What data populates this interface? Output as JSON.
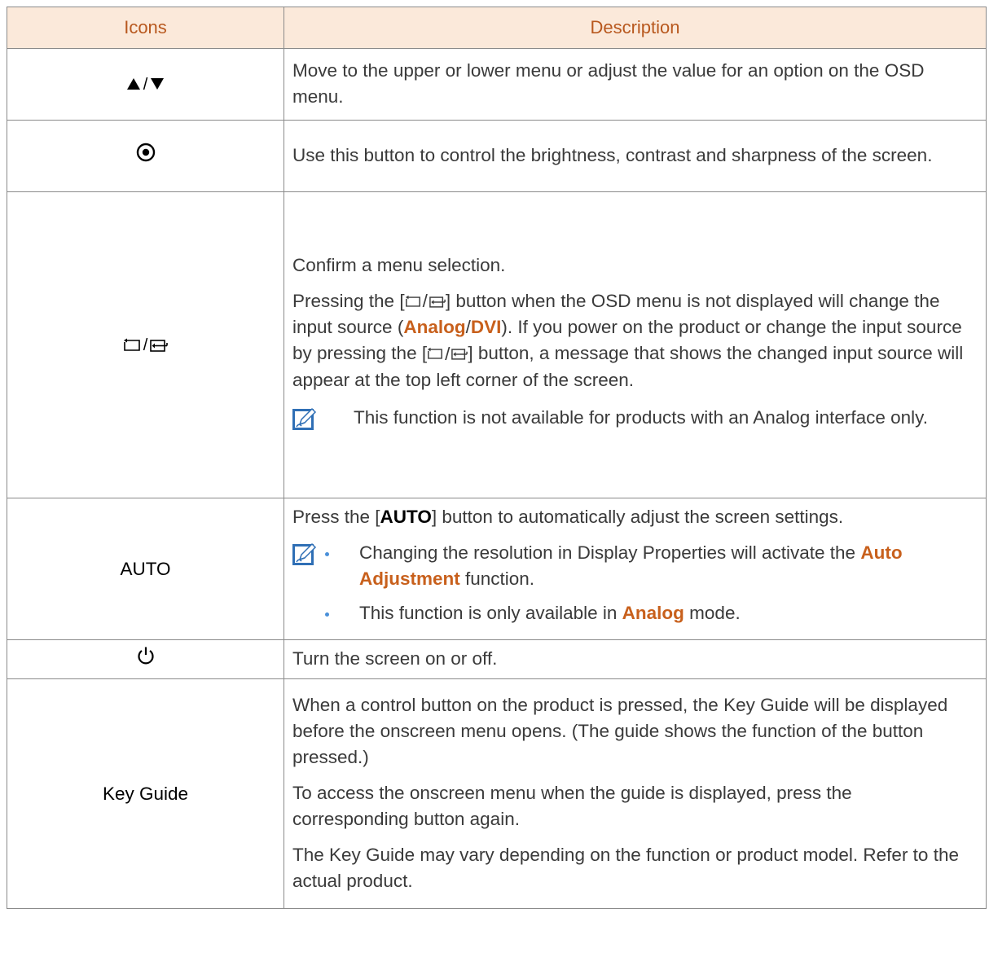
{
  "table": {
    "headers": {
      "icons": "Icons",
      "description": "Description"
    },
    "rows": {
      "updown": {
        "desc": "Move to the upper or lower menu or adjust the value for an option on the OSD menu."
      },
      "brightness": {
        "desc": "Use this button to control the brightness, contrast and sharpness of the screen."
      },
      "source": {
        "desc1": "Confirm a menu selection.",
        "desc2a": "Pressing the [",
        "desc2b": "] button when the OSD menu is not displayed will change the input source (",
        "analog": "Analog",
        "slash": "/",
        "dvi": "DVI",
        "desc2c": "). If you power on the product or change the input source by pressing the [",
        "desc2d": "] button, a message that shows the changed input source will appear at the top left corner of the screen.",
        "note": "This function is not available for products with an Analog interface only."
      },
      "auto": {
        "icon_label": "AUTO",
        "desc_a": "Press the [",
        "desc_key": "AUTO",
        "desc_b": "] button to automatically adjust the screen settings.",
        "bullet1_a": "Changing the resolution in Display Properties will activate the ",
        "bullet1_hl": "Auto Adjustment",
        "bullet1_b": " function.",
        "bullet2_a": "This function is only available in ",
        "bullet2_hl": "Analog",
        "bullet2_b": " mode."
      },
      "power": {
        "desc": "Turn the screen on or off."
      },
      "keyguide": {
        "icon_label": "Key Guide",
        "desc1": "When a control button on the product is pressed, the Key Guide will be displayed before the onscreen menu opens. (The guide shows the function of the button pressed.)",
        "desc2": "To access the onscreen menu when the guide is displayed, press the corresponding button again.",
        "desc3": "The Key Guide may vary depending on the function or product model. Refer to the actual product."
      }
    }
  },
  "colors": {
    "header_bg": "#fbe9da",
    "header_text": "#b8581e",
    "highlight": "#c8601c",
    "border": "#8a8a8a"
  },
  "icons": {
    "updown": "up-down-triangle-icons",
    "brightness": "target-circle-icon",
    "source": "menu-source-icons",
    "note": "pencil-note-icon",
    "power": "power-icon"
  }
}
